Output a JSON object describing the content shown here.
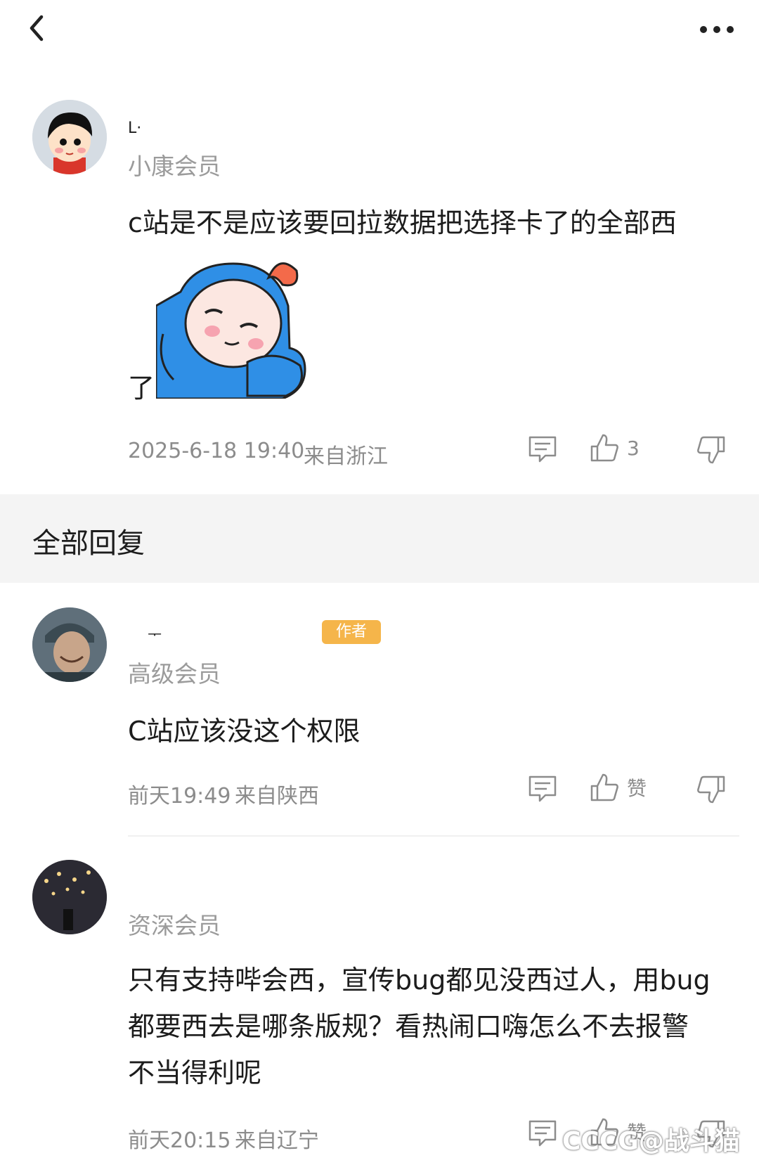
{
  "header": {
    "back_icon": "chevron-left-icon",
    "more_icon": "more-horizontal-icon"
  },
  "main_comment": {
    "name": "L·",
    "level": "小康会员",
    "text_line1": "c站是不是应该要回拉数据把选择卡了的全部西",
    "text_line2": "了",
    "sticker_icon": "blue-creature-sticker-icon",
    "time": "2025-6-18 19:40",
    "location": "来自浙江",
    "likes": "3"
  },
  "replies_header": "全部回复",
  "replies": [
    {
      "name": "ᅮ",
      "badge": "作者",
      "level": "高级会员",
      "text": "C站应该没这个权限",
      "time": "前天19:49",
      "location": "来自陕西",
      "like_label": "赞"
    },
    {
      "name": "",
      "level": "资深会员",
      "text_lines": [
        "只有支持哔会西，宣传bug都见没西过人，用bug",
        "都要西去是哪条版规？看热闹口嗨怎么不去报警",
        "不当得利呢"
      ],
      "time": "前天20:15",
      "location": "来自辽宁",
      "like_label": "赞"
    }
  ],
  "watermark": "CCCG@战斗猫"
}
